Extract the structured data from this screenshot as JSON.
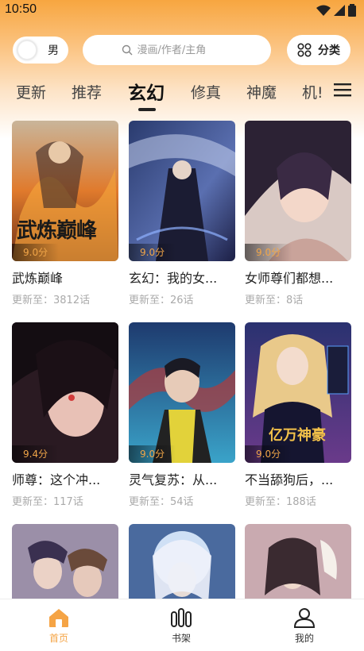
{
  "status_bar": {
    "time": "10:50"
  },
  "header": {
    "gender_label": "男",
    "search_placeholder": "漫画/作者/主角",
    "category_label": "分类"
  },
  "tabs": [
    {
      "label": "更新"
    },
    {
      "label": "推荐"
    },
    {
      "label": "玄幻",
      "active": true
    },
    {
      "label": "修真"
    },
    {
      "label": "神魔"
    },
    {
      "label": "机!"
    }
  ],
  "comics": [
    {
      "title": "武炼巅峰",
      "update": "更新至：3812话",
      "score": "9.0分",
      "cover_text": "武炼巅峰"
    },
    {
      "title": "玄幻：我的女...",
      "update": "更新至：26话",
      "score": "9.0分",
      "cover_text": ""
    },
    {
      "title": "女师尊们都想...",
      "update": "更新至：8话",
      "score": "9.0分",
      "cover_text": ""
    },
    {
      "title": "师尊：这个冲...",
      "update": "更新至：117话",
      "score": "9.4分",
      "cover_text": ""
    },
    {
      "title": "灵气复苏：从...",
      "update": "更新至：54话",
      "score": "9.0分",
      "cover_text": ""
    },
    {
      "title": "不当舔狗后，...",
      "update": "更新至：188话",
      "score": "9.0分",
      "cover_text": "亿万神豪"
    },
    {
      "title": "",
      "update": "",
      "score": "",
      "cover_text": ""
    },
    {
      "title": "",
      "update": "",
      "score": "",
      "cover_text": ""
    },
    {
      "title": "",
      "update": "",
      "score": "",
      "cover_text": ""
    }
  ],
  "bottom_nav": [
    {
      "label": "首页",
      "icon": "home-icon",
      "active": true
    },
    {
      "label": "书架",
      "icon": "bookshelf-icon"
    },
    {
      "label": "我的",
      "icon": "user-icon"
    }
  ],
  "colors": {
    "accent": "#f5a445",
    "score": "#f0a548"
  }
}
